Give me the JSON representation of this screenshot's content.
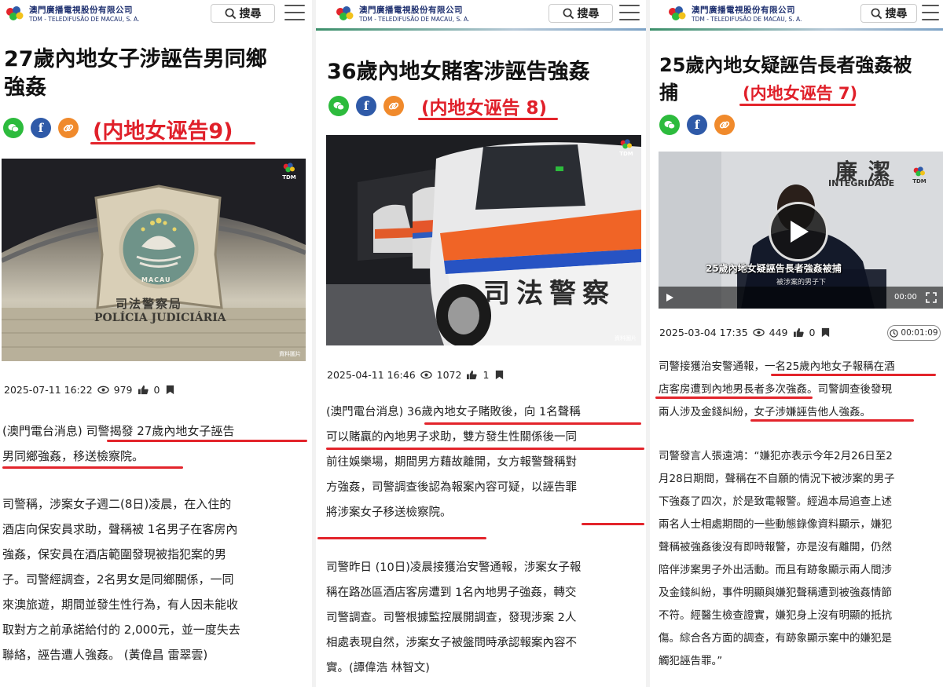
{
  "brand": {
    "name_zh": "澳門廣播電視股份有限公司",
    "name_pt": "TDM - TELEDIFUSÃO DE MACAU, S. A."
  },
  "header": {
    "search_label": "搜尋"
  },
  "colors": {
    "accent": "#e3242b",
    "brand": "#1d2f6f",
    "wechat": "#2dbb3d",
    "facebook": "#2f5aa8",
    "link": "#f08a2c"
  },
  "icons": [
    "search-icon",
    "menu-icon",
    "wechat-icon",
    "facebook-icon",
    "link-icon",
    "eye-icon",
    "thumbs-up-icon",
    "bookmark-icon",
    "play-icon",
    "clock-icon"
  ],
  "articles": [
    {
      "title": "27歲內地女子涉誣告男同鄉強姦",
      "title_l1": "27歲內地女子涉誣告男同鄉",
      "title_l2": "強姦",
      "note": "(内地女诬告9)",
      "image_sign_zh": "司法警察局",
      "image_sign_pt": "POLÍCIA JUDICIÁRIA",
      "image_emblem": "MACAU",
      "watermark": "資料圖片",
      "date": "2025-07-11 16:22",
      "views": "979",
      "likes": "0",
      "paragraphs": [
        [
          "(澳門電台消息) 司警揭發 27歲內地女子誣告",
          "男同鄉強姦，移送檢察院。"
        ],
        [
          "司警稱，涉案女子週二(8日)凌晨，在入住的",
          "酒店向保安員求助，聲稱被 1名男子在客房內",
          "強姦，保安員在酒店範圍發現被指犯案的男",
          "子。司警經調查，2名男女是同鄉關係，一同",
          "來澳旅遊，期間並發生性行為，有人因未能收",
          "取對方之前承諾給付的 2,000元，並一度失去",
          "聯絡，誣告遭人強姦。 (黃偉昌  雷翠雲)"
        ]
      ]
    },
    {
      "title": "36歲內地女賭客涉誣告強姦",
      "note": "(内地女诬告 8)",
      "image_sign_zh": "司法警察",
      "watermark": "資料圖片",
      "date": "2025-04-11 16:46",
      "views": "1072",
      "likes": "1",
      "paragraphs": [
        [
          "(澳門電台消息) 36歲內地女子賭敗後，向 1名聲稱",
          "可以賭贏的內地男子求助，雙方發生性關係後一同",
          "前往娛樂場，期間男方藉故離開，女方報警聲稱對",
          "方強姦，司警調查後認為報案內容可疑，以誣告罪",
          "將涉案女子移送檢察院。"
        ],
        [
          "司警昨日 (10日)凌晨接獲治安警通報，涉案女子報",
          "稱在路氹區酒店客房遭到 1名內地男子強姦，轉交",
          "司警調查。司警根據監控展開調查，發現涉案 2人",
          "相處表現自然，涉案女子被盤問時承認報案內容不",
          "實。(譚偉浩 林智文)"
        ]
      ]
    },
    {
      "title_l1": "25歲內地女疑誣告長者強姦被",
      "title_l2": "捕",
      "note": "(内地女诬告 7)",
      "video_sign_zh": "廉潔",
      "video_sign_pt": "INTEGRIDADE",
      "video_caption": "25歲內地女疑誣告長者強姦被捕",
      "video_sub": "被涉案的男子下",
      "video_time": "00:00",
      "date": "2025-03-04 17:35",
      "views": "449",
      "likes": "0",
      "duration": "00:01:09",
      "paragraphs": [
        [
          "司警接獲治安警通報，一名25歲內地女子報稱在酒",
          "店客房遭到內地男長者多次強姦。司警調查後發現",
          "兩人涉及金錢糾紛，女子涉嫌誣告他人強姦。"
        ],
        [
          "司警發言人張遠鴻：“嫌犯亦表示今年2月26日至2",
          "月28日期間，聲稱在不自願的情況下被涉案的男子",
          "下強姦了四次，於是致電報警。經過本局追查上述",
          "兩名人士相處期間的一些動態錄像資料顯示，嫌犯",
          "聲稱被強姦後沒有即時報警，亦是沒有離開，仍然",
          "陪伴涉案男子外出活動。而且有跡象顯示兩人間涉",
          "及金錢糾紛，事件明顯與嫌犯聲稱遭到被強姦情節",
          "不符。經醫生檢查證實，嫌犯身上沒有明顯的抵抗",
          "傷。綜合各方面的調查，有跡象顯示案中的嫌犯是",
          "觸犯誣告罪。”"
        ]
      ]
    }
  ]
}
